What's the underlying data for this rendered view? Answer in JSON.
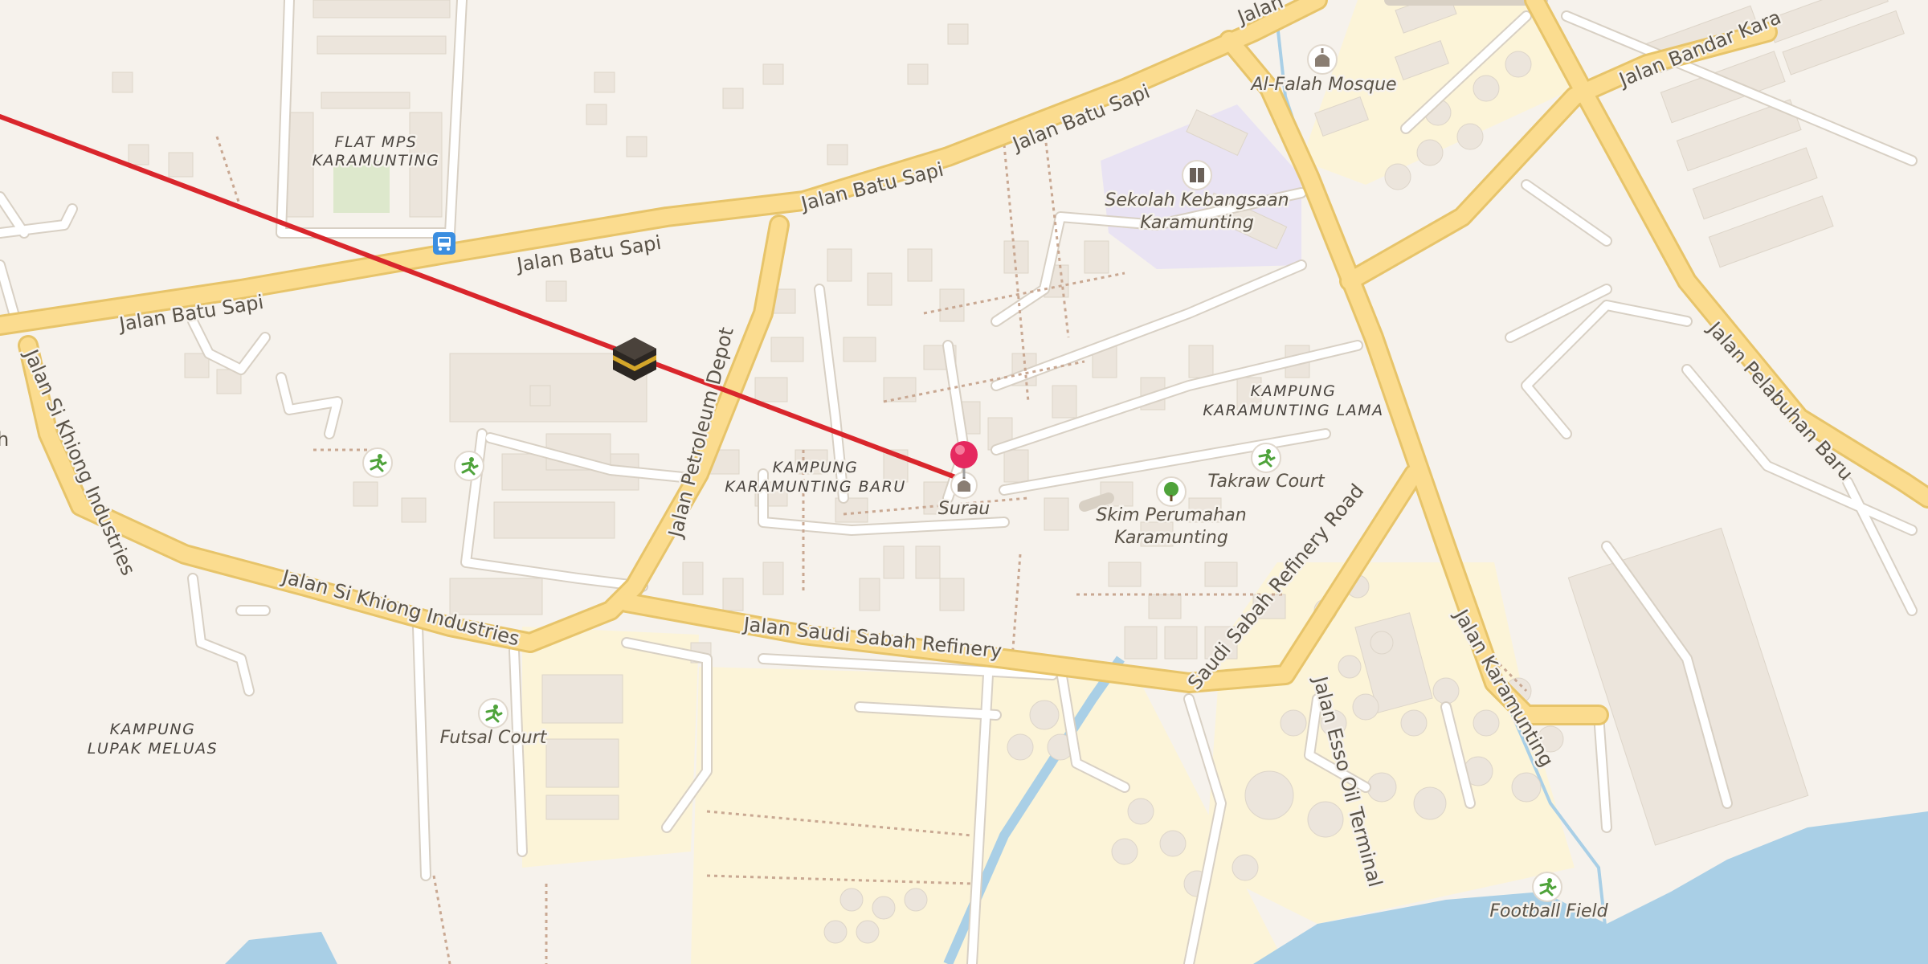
{
  "map": {
    "roads": {
      "batu_sapi_1": "Jalan Batu Sapi",
      "batu_sapi_2": "Jalan Batu Sapi",
      "batu_sapi_3": "Jalan Batu Sapi",
      "batu_sapi_4": "Jalan Batu Sapi",
      "jalan_top": "Jalan",
      "bandar_kara": "Jalan Bandar Kara",
      "petroleum_depot": "Jalan Petroleum Depot",
      "si_khiong_1": "Jalan Si Khiong Industries",
      "si_khiong_2": "Jalan Si Khiong Industries",
      "saudi_sabah_refinery": "Jalan Saudi Sabah Refinery",
      "saudi_sabah_refinery_road": "Saudi Sabah Refinery Road",
      "esso_oil_terminal": "Jalan Esso Oil Terminal",
      "karamunting": "Jalan Karamunting",
      "pelabuhan_baru": "Jalan Pelabuhan Baru",
      "edge_h": "h"
    },
    "areas": {
      "flat_mps_1": "FLAT MPS",
      "flat_mps_2": "KARAMUNTING",
      "kampung_baru_1": "KAMPUNG",
      "kampung_baru_2": "KARAMUNTING BARU",
      "kampung_lama_1": "KAMPUNG",
      "kampung_lama_2": "KARAMUNTING LAMA",
      "kampung_lupak_1": "KAMPUNG",
      "kampung_lupak_2": "LUPAK MELUAS"
    },
    "pois": {
      "al_falah": "Al-Falah Mosque",
      "sekolah_1": "Sekolah Kebangsaan",
      "sekolah_2": "Karamunting",
      "surau": "Surau",
      "skim_1": "Skim Perumahan",
      "skim_2": "Karamunting",
      "takraw": "Takraw Court",
      "futsal": "Futsal Court",
      "football": "Football Field"
    },
    "colors": {
      "land": "#f6f2ec",
      "major_road": "#fbdc8f",
      "road_casing": "#e7c46a",
      "minor_road": "#ffffff",
      "building": "#ece5dc",
      "industrial": "#fcf4d8",
      "water": "#a9cfe6",
      "qibla_line": "#d9262c",
      "pin": "#e5285f"
    },
    "icons": [
      "bus-stop-icon",
      "mosque-icon",
      "school-icon",
      "sports-icon",
      "park-icon",
      "kaaba-icon",
      "location-pin-icon"
    ]
  }
}
